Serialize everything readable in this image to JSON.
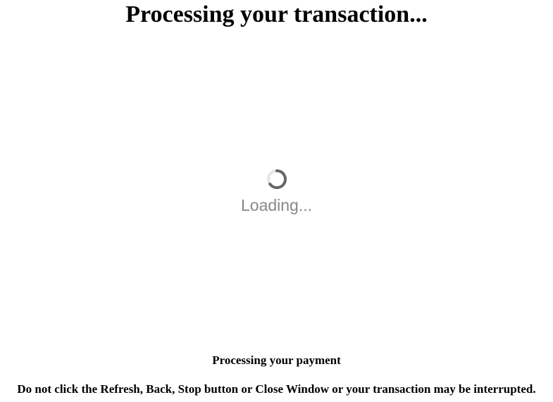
{
  "page": {
    "title": "Processing your transaction...",
    "loader": {
      "icon": "spinner-icon",
      "text": "Loading...",
      "text_color": "#888888",
      "spinner_color": "#666666"
    },
    "status": "Processing your payment",
    "warning": "Do not click the Refresh, Back, Stop button or Close Window or your transaction may be interrupted."
  }
}
